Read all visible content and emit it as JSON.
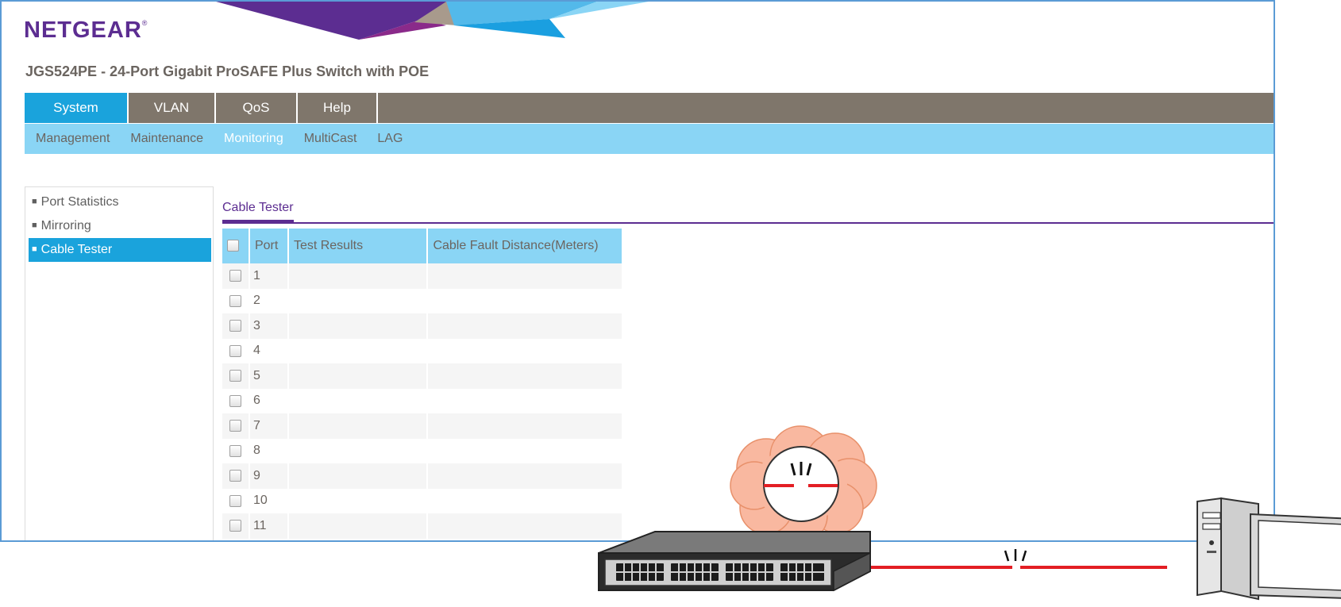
{
  "brand": {
    "logo_text": "NETGEAR",
    "registered": "®"
  },
  "product_title": "JGS524PE - 24-Port Gigabit ProSAFE Plus Switch with POE",
  "main_nav": [
    {
      "label": "System",
      "active": true
    },
    {
      "label": "VLAN",
      "active": false
    },
    {
      "label": "QoS",
      "active": false
    },
    {
      "label": "Help",
      "active": false
    }
  ],
  "sub_nav": [
    {
      "label": "Management",
      "active": false
    },
    {
      "label": "Maintenance",
      "active": false
    },
    {
      "label": "Monitoring",
      "active": true
    },
    {
      "label": "MultiCast",
      "active": false
    },
    {
      "label": "LAG",
      "active": false
    }
  ],
  "sidebar": [
    {
      "label": "Port Statistics",
      "active": false
    },
    {
      "label": "Mirroring",
      "active": false
    },
    {
      "label": "Cable Tester",
      "active": true
    }
  ],
  "section_title": "Cable Tester",
  "table": {
    "headers": {
      "port": "Port",
      "result": "Test Results",
      "distance": "Cable Fault Distance(Meters)"
    },
    "rows": [
      {
        "port": "1",
        "result": "",
        "distance": ""
      },
      {
        "port": "2",
        "result": "",
        "distance": ""
      },
      {
        "port": "3",
        "result": "",
        "distance": ""
      },
      {
        "port": "4",
        "result": "",
        "distance": ""
      },
      {
        "port": "5",
        "result": "",
        "distance": ""
      },
      {
        "port": "6",
        "result": "",
        "distance": ""
      },
      {
        "port": "7",
        "result": "",
        "distance": ""
      },
      {
        "port": "8",
        "result": "",
        "distance": ""
      },
      {
        "port": "9",
        "result": "",
        "distance": ""
      },
      {
        "port": "10",
        "result": "",
        "distance": ""
      },
      {
        "port": "11",
        "result": "",
        "distance": ""
      }
    ]
  },
  "colors": {
    "brand_purple": "#5c2d91",
    "nav_gray": "#7f766b",
    "nav_active_blue": "#1aa3dc",
    "subnav_light_blue": "#8ad5f5",
    "fault_red": "#e31e24",
    "cloud_salmon": "#f9b8a0"
  },
  "illustration": {
    "icons": [
      "network-switch-icon",
      "desktop-computer-icon",
      "broken-cable-icon",
      "thought-bubble-icon"
    ]
  }
}
